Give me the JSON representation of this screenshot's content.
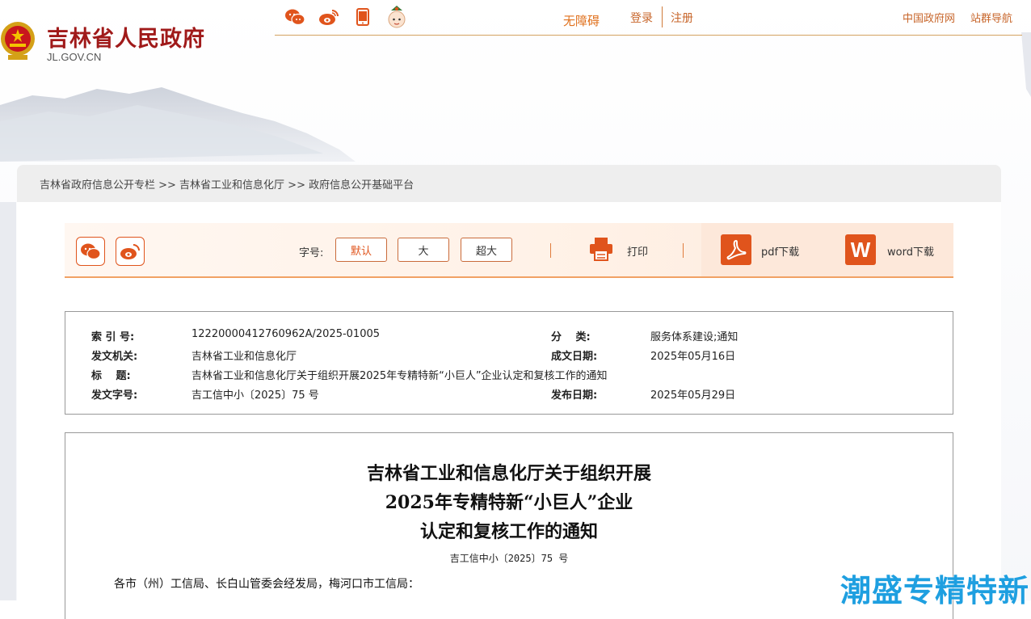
{
  "header": {
    "site_title": "吉林省人民政府",
    "site_domain": "JL.GOV.CN",
    "share_icons": [
      "wechat-icon",
      "weibo-icon",
      "mobile-icon",
      "mascot-icon"
    ],
    "accessible_label": "无障碍",
    "login_label": "登录",
    "register_label": "注册",
    "gov_link_label": "中国政府网",
    "site_nav_label": "站群导航"
  },
  "breadcrumb": {
    "text": "吉林省政府信息公开专栏 >> 吉林省工业和信息化厅 >> 政府信息公开基础平台"
  },
  "toolbar": {
    "font_label": "字号:",
    "font_default": "默认",
    "font_large": "大",
    "font_xlarge": "超大",
    "print_label": "打印",
    "pdf_label": "pdf下载",
    "word_label": "word下载",
    "word_icon_letter": "W"
  },
  "meta": {
    "index_label": "索 引 号:",
    "index_value": "12220000412760962A/2025-01005",
    "category_label": "分　 类:",
    "category_value": "服务体系建设;通知",
    "issuer_label": "发文机关:",
    "issuer_value": "吉林省工业和信息化厅",
    "created_label": "成文日期:",
    "created_value": "2025年05月16日",
    "title_label": "标　 题:",
    "title_value": "吉林省工业和信息化厅关于组织开展2025年专精特新“小巨人”企业认定和复核工作的通知",
    "doc_no_label": "发文字号:",
    "doc_no_value": "吉工信中小〔2025〕75 号",
    "published_label": "发布日期:",
    "published_value": "2025年05月29日"
  },
  "document": {
    "title_line1": "吉林省工业和信息化厅关于组织开展",
    "title_line2": "2025年专精特新“小巨人”企业",
    "title_line3": "认定和复核工作的通知",
    "number": "吉工信中小〔2025〕75 号",
    "recipient": "各市（州）工信局、长白山管委会经发局，梅河口市工信局："
  },
  "watermark": "潮盛专精特新",
  "colors": {
    "accent": "#e0541c",
    "title_red": "#a01a1a",
    "link_orange": "#c7652a",
    "watermark_blue": "#1e9fe0"
  }
}
